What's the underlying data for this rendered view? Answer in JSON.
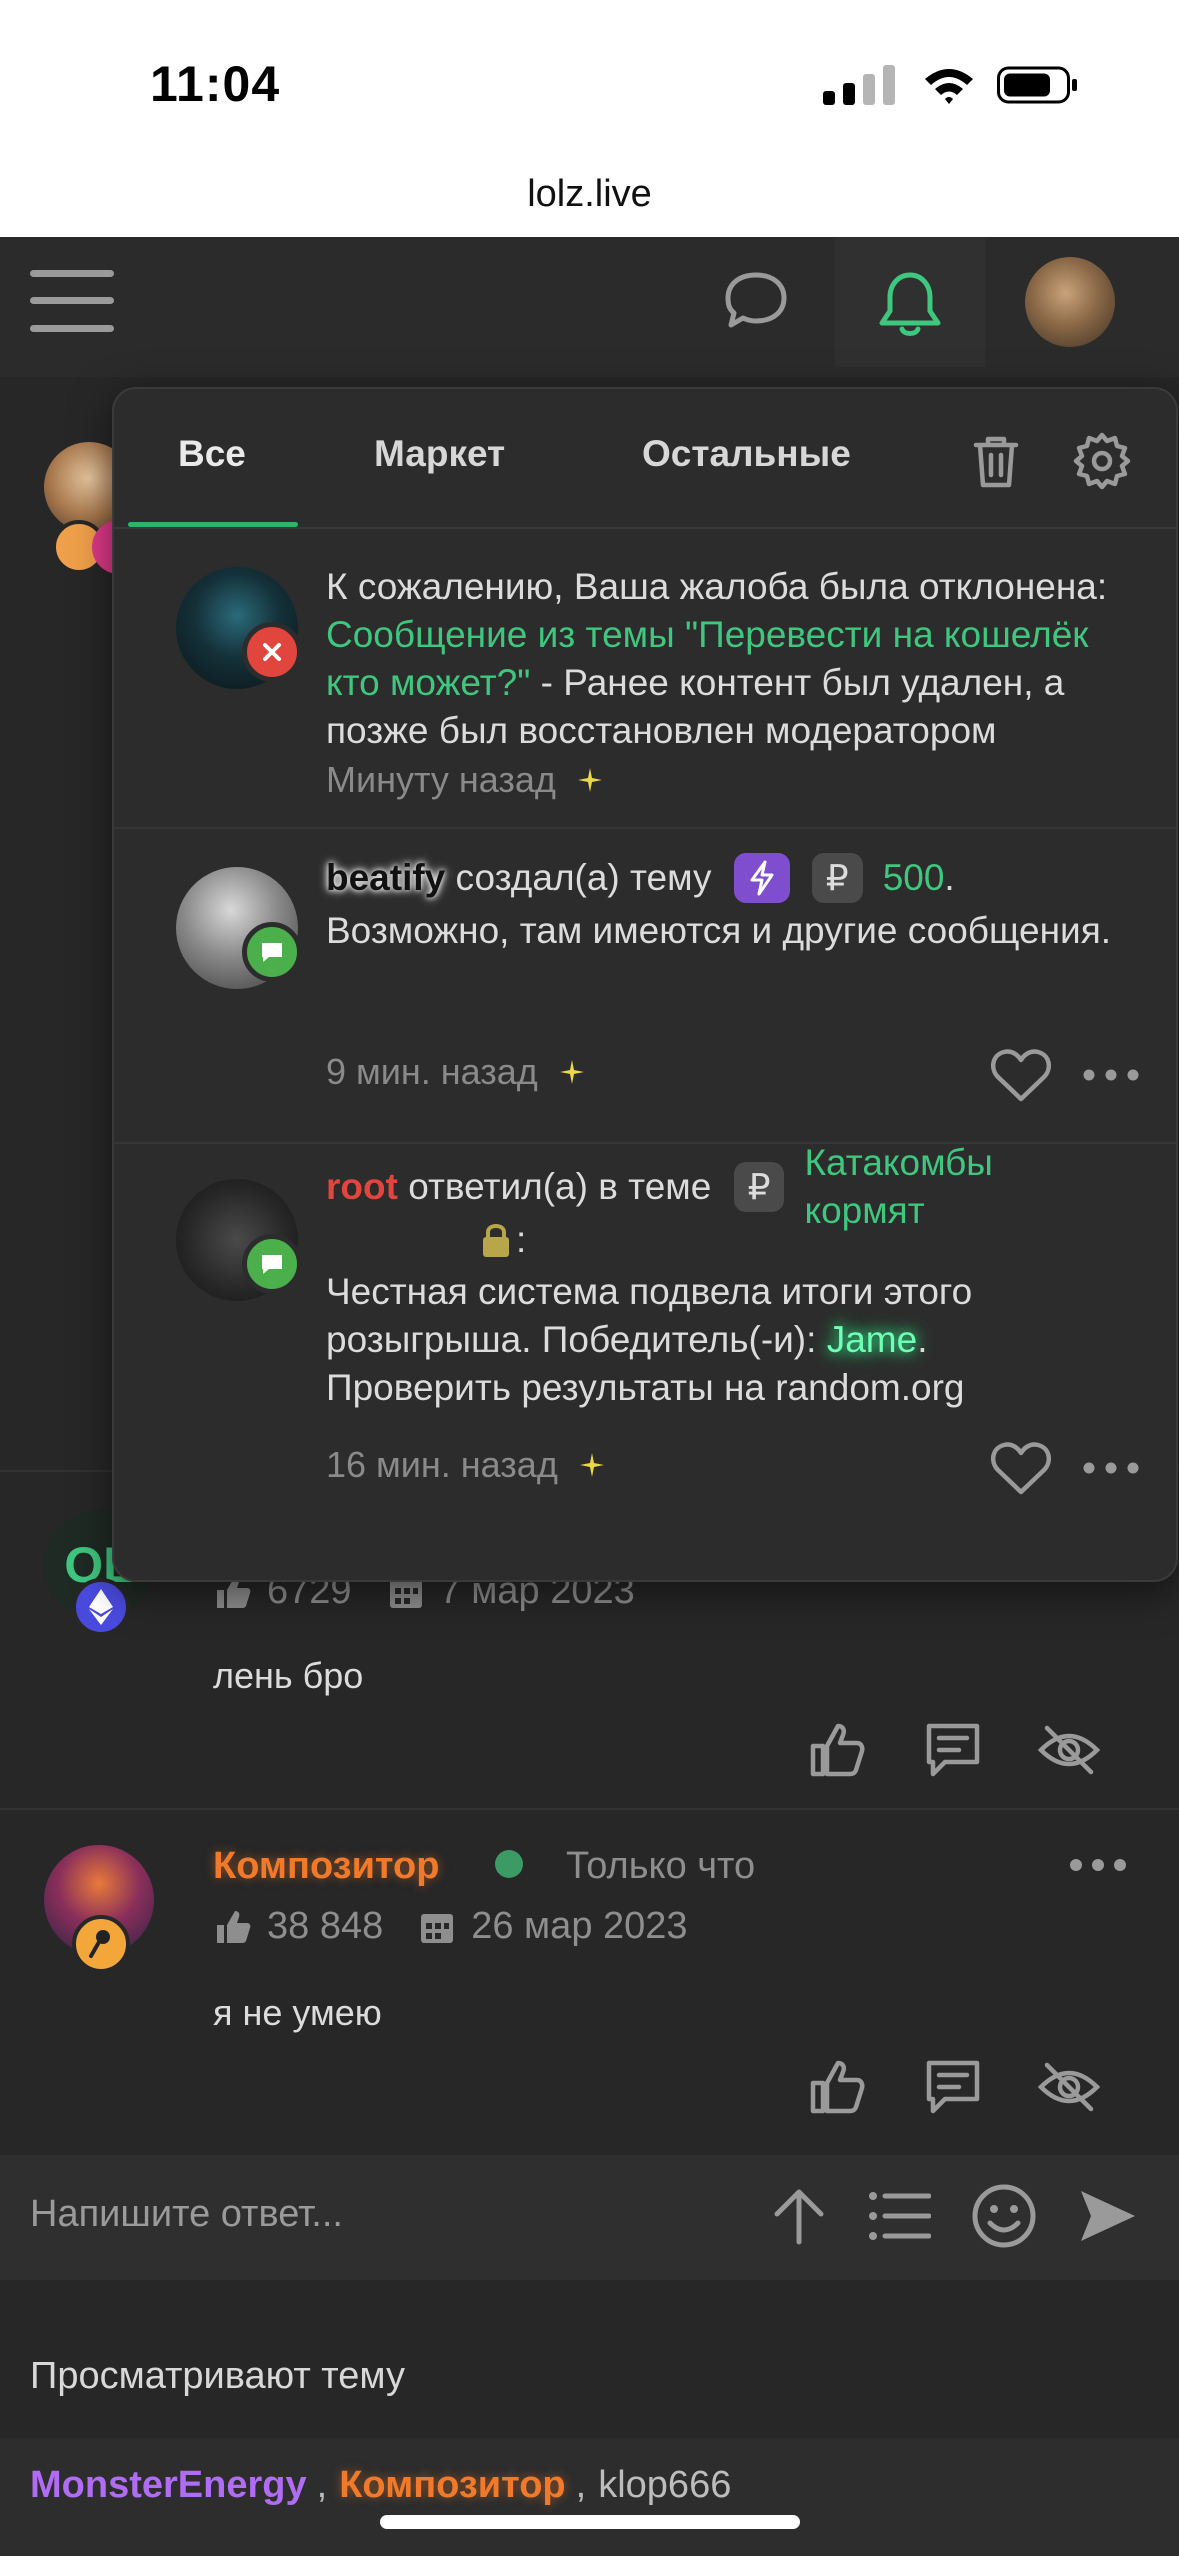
{
  "status_bar": {
    "time": "11:04"
  },
  "browser": {
    "url": "lolz.live"
  },
  "notifications": {
    "tabs": [
      {
        "label": "Все"
      },
      {
        "label": "Маркет"
      },
      {
        "label": "Остальные"
      }
    ],
    "items": [
      {
        "text_prefix": "К сожалению, Ваша жалоба была отклонена: ",
        "link": "Сообщение из темы \"Перевести на кошелёк кто может?\"",
        "text_suffix": " - Ранее контент был удален, а позже был восстановлен модератором",
        "time": "Минуту назад"
      },
      {
        "user": "beatify",
        "action": " создал(а) тему ",
        "currency": "₽",
        "amount": "500",
        "amount_suffix": ".",
        "line2": "Возможно, там имеются и другие сообщения.",
        "time": "9 мин. назад"
      },
      {
        "user": "root",
        "action": " ответил(а) в теме ",
        "currency": "₽",
        "thread": "Катакомбы кормят",
        "colon": ":",
        "line2": "Честная система подвела итоги этого розыгрыша. Победитель(-и): ",
        "winner": "Jame",
        "line2_end": ".",
        "line3": "Проверить результаты на random.org",
        "time": "16 мин. назад"
      }
    ]
  },
  "posts": [
    {
      "avatar_text": "OL",
      "likes": "6729",
      "date": "7 мар 2023",
      "text": "лень бро"
    },
    {
      "username": "Композитор",
      "status": "Только что",
      "likes": "38 848",
      "date": "26 мар 2023",
      "text": "я не умею"
    }
  ],
  "reply": {
    "placeholder": "Напишите ответ..."
  },
  "viewers": {
    "title": "Просматривают тему",
    "list": [
      "MonsterEnergy",
      "Композитор",
      "klop666"
    ],
    "sep": ","
  },
  "colors": {
    "accent": "#3fc77f",
    "root": "#e0453e",
    "purple": "#b06cf2",
    "orange": "#f07a2a"
  }
}
